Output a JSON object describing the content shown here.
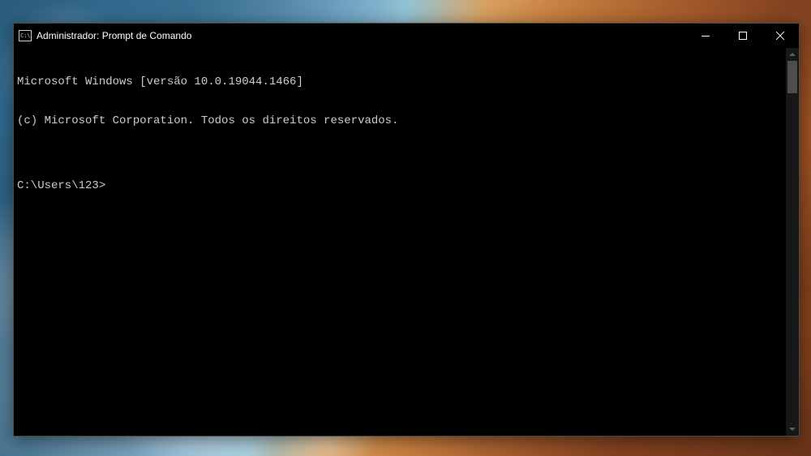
{
  "window": {
    "title": "Administrador: Prompt de Comando",
    "icon_label": "C:\\"
  },
  "terminal": {
    "lines": [
      "Microsoft Windows [versão 10.0.19044.1466]",
      "(c) Microsoft Corporation. Todos os direitos reservados.",
      "",
      "C:\\Users\\123>"
    ],
    "prompt": "C:\\Users\\123>"
  }
}
